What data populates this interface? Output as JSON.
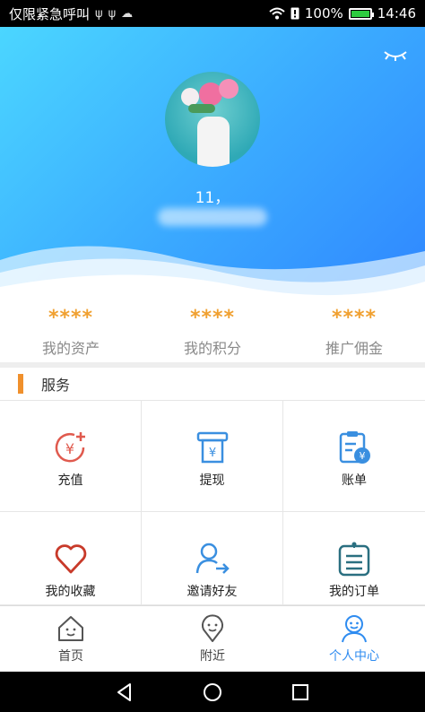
{
  "status_bar": {
    "carrier": "仅限紧急呼叫",
    "icons": [
      "usb-icon",
      "usb-icon",
      "cloud-icon"
    ],
    "wifi": "wifi-icon",
    "battery_percent": "100%",
    "battery_level": 1.0,
    "time": "14:46"
  },
  "profile": {
    "username": "11，",
    "avatar": "avatar-flowers"
  },
  "stats": [
    {
      "value": "****",
      "label": "我的资产"
    },
    {
      "value": "****",
      "label": "我的积分"
    },
    {
      "value": "****",
      "label": "推广佣金"
    }
  ],
  "section": {
    "title": "服务"
  },
  "services": [
    {
      "label": "充值",
      "icon": "recharge-icon",
      "color": "#e05a4e"
    },
    {
      "label": "提现",
      "icon": "withdraw-icon",
      "color": "#3a8fe0"
    },
    {
      "label": "账单",
      "icon": "bill-icon",
      "color": "#3a8fe0"
    },
    {
      "label": "我的收藏",
      "icon": "heart-icon",
      "color": "#c83a2a"
    },
    {
      "label": "邀请好友",
      "icon": "invite-icon",
      "color": "#3a8fe0"
    },
    {
      "label": "我的订单",
      "icon": "order-icon",
      "color": "#2a6f80"
    }
  ],
  "tabs": [
    {
      "label": "首页",
      "icon": "home-icon",
      "active": false
    },
    {
      "label": "附近",
      "icon": "nearby-icon",
      "active": false
    },
    {
      "label": "个人中心",
      "icon": "profile-icon",
      "active": true
    }
  ],
  "colors": {
    "accent": "#2f8cf0",
    "stat_value": "#f0a030",
    "section_bar": "#f0902c"
  }
}
